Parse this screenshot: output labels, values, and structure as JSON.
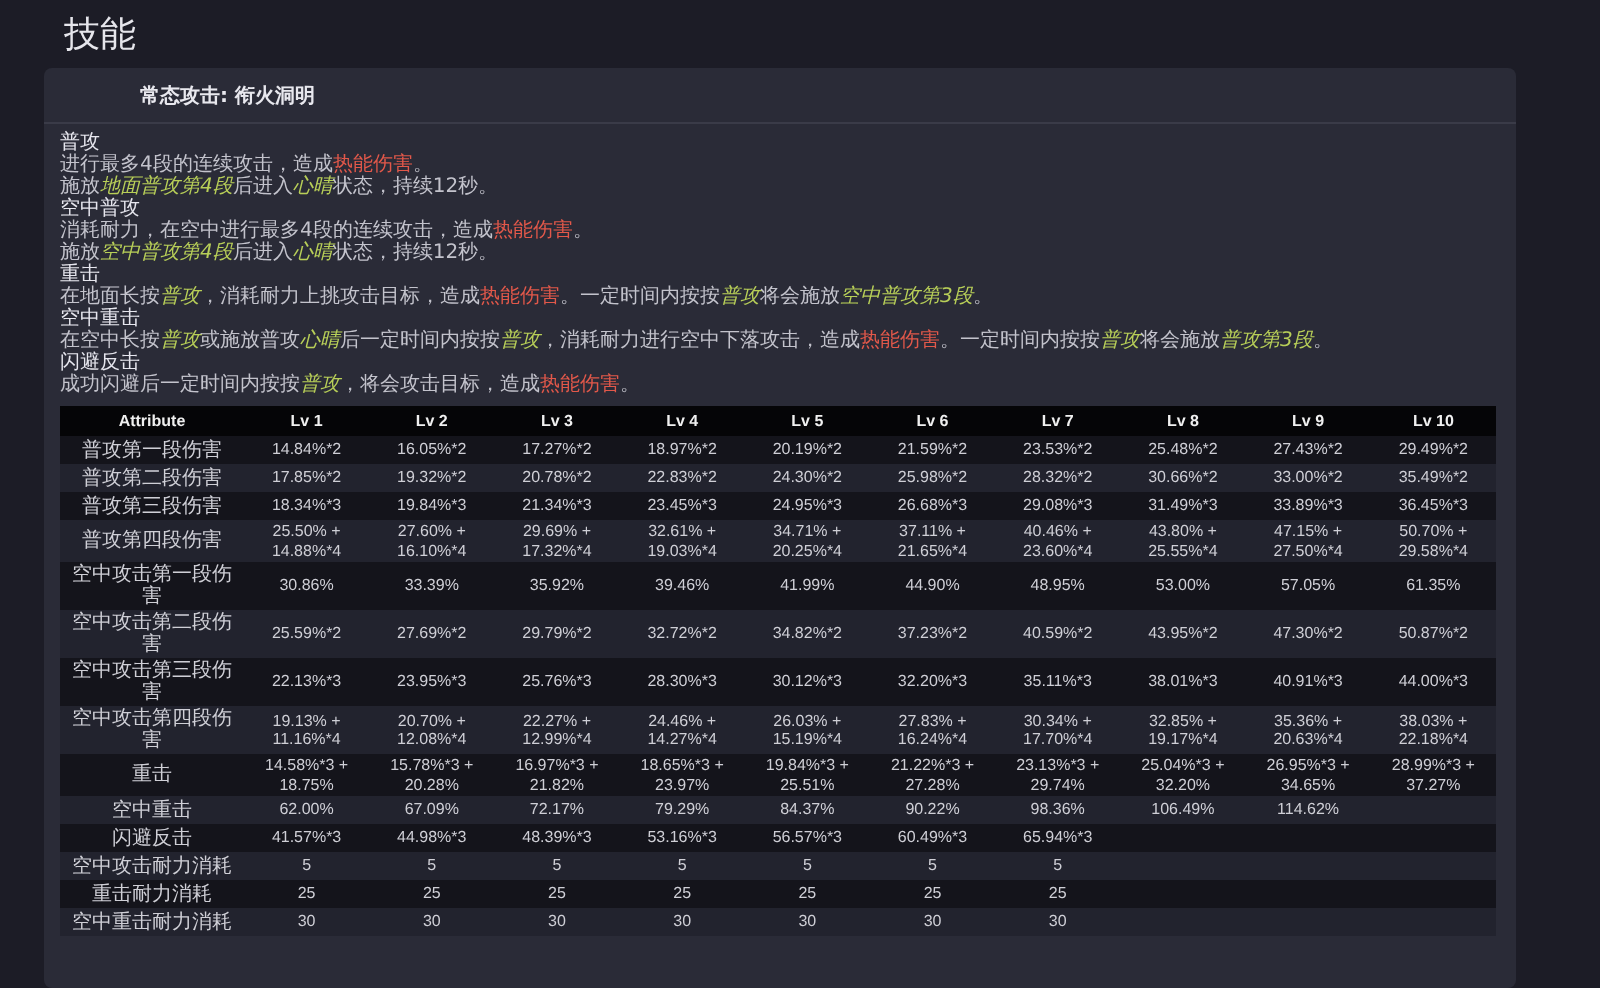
{
  "page_title": "技能",
  "card": {
    "title": "常态攻击: 衔火洞明",
    "description": [
      {
        "kind": "heading",
        "segments": [
          {
            "kind": "plain",
            "text": "普攻"
          }
        ]
      },
      {
        "kind": "text",
        "segments": [
          {
            "kind": "plain",
            "text": "进行最多4段的连续攻击，造成"
          },
          {
            "kind": "damage",
            "text": "热能伤害"
          },
          {
            "kind": "plain",
            "text": "。"
          }
        ]
      },
      {
        "kind": "text",
        "segments": [
          {
            "kind": "plain",
            "text": "施放"
          },
          {
            "kind": "keyword",
            "text": "地面普攻第4段"
          },
          {
            "kind": "plain",
            "text": "后进入"
          },
          {
            "kind": "keyword",
            "text": "心晴"
          },
          {
            "kind": "plain",
            "text": "状态，持续12秒。"
          }
        ]
      },
      {
        "kind": "heading",
        "segments": [
          {
            "kind": "plain",
            "text": "空中普攻"
          }
        ]
      },
      {
        "kind": "text",
        "segments": [
          {
            "kind": "plain",
            "text": "消耗耐力，在空中进行最多4段的连续攻击，造成"
          },
          {
            "kind": "damage",
            "text": "热能伤害"
          },
          {
            "kind": "plain",
            "text": "。"
          }
        ]
      },
      {
        "kind": "text",
        "segments": [
          {
            "kind": "plain",
            "text": "施放"
          },
          {
            "kind": "keyword",
            "text": "空中普攻第4段"
          },
          {
            "kind": "plain",
            "text": "后进入"
          },
          {
            "kind": "keyword",
            "text": "心晴"
          },
          {
            "kind": "plain",
            "text": "状态，持续12秒。"
          }
        ]
      },
      {
        "kind": "heading",
        "segments": [
          {
            "kind": "plain",
            "text": "重击"
          }
        ]
      },
      {
        "kind": "text",
        "segments": [
          {
            "kind": "plain",
            "text": "在地面长按"
          },
          {
            "kind": "keyword",
            "text": "普攻"
          },
          {
            "kind": "plain",
            "text": "，消耗耐力上挑攻击目标，造成"
          },
          {
            "kind": "damage",
            "text": "热能伤害"
          },
          {
            "kind": "plain",
            "text": "。一定时间内按按"
          },
          {
            "kind": "keyword",
            "text": "普攻"
          },
          {
            "kind": "plain",
            "text": "将会施放"
          },
          {
            "kind": "keyword",
            "text": "空中普攻第3段"
          },
          {
            "kind": "plain",
            "text": "。"
          }
        ]
      },
      {
        "kind": "heading",
        "segments": [
          {
            "kind": "plain",
            "text": "空中重击"
          }
        ]
      },
      {
        "kind": "text",
        "segments": [
          {
            "kind": "plain",
            "text": "在空中长按"
          },
          {
            "kind": "keyword",
            "text": "普攻"
          },
          {
            "kind": "plain",
            "text": "或施放普攻"
          },
          {
            "kind": "keyword",
            "text": "心晴"
          },
          {
            "kind": "plain",
            "text": "后一定时间内按按"
          },
          {
            "kind": "keyword",
            "text": "普攻"
          },
          {
            "kind": "plain",
            "text": "，消耗耐力进行空中下落攻击，造成"
          },
          {
            "kind": "damage",
            "text": "热能伤害"
          },
          {
            "kind": "plain",
            "text": "。一定时间内按按"
          },
          {
            "kind": "keyword",
            "text": "普攻"
          },
          {
            "kind": "plain",
            "text": "将会施放"
          },
          {
            "kind": "keyword",
            "text": "普攻第3段"
          },
          {
            "kind": "plain",
            "text": "。"
          }
        ]
      },
      {
        "kind": "heading",
        "segments": [
          {
            "kind": "plain",
            "text": "闪避反击"
          }
        ]
      },
      {
        "kind": "text",
        "segments": [
          {
            "kind": "plain",
            "text": "成功闪避后一定时间内按按"
          },
          {
            "kind": "keyword",
            "text": "普攻"
          },
          {
            "kind": "plain",
            "text": "，将会攻击目标，造成"
          },
          {
            "kind": "damage",
            "text": "热能伤害"
          },
          {
            "kind": "plain",
            "text": "。"
          }
        ]
      }
    ],
    "table": {
      "columns": [
        "Attribute",
        "Lv 1",
        "Lv 2",
        "Lv 3",
        "Lv 4",
        "Lv 5",
        "Lv 6",
        "Lv 7",
        "Lv 8",
        "Lv 9",
        "Lv 10"
      ],
      "rows": [
        [
          "普攻第一段伤害",
          "14.84%*2",
          "16.05%*2",
          "17.27%*2",
          "18.97%*2",
          "20.19%*2",
          "21.59%*2",
          "23.53%*2",
          "25.48%*2",
          "27.43%*2",
          "29.49%*2"
        ],
        [
          "普攻第二段伤害",
          "17.85%*2",
          "19.32%*2",
          "20.78%*2",
          "22.83%*2",
          "24.30%*2",
          "25.98%*2",
          "28.32%*2",
          "30.66%*2",
          "33.00%*2",
          "35.49%*2"
        ],
        [
          "普攻第三段伤害",
          "18.34%*3",
          "19.84%*3",
          "21.34%*3",
          "23.45%*3",
          "24.95%*3",
          "26.68%*3",
          "29.08%*3",
          "31.49%*3",
          "33.89%*3",
          "36.45%*3"
        ],
        [
          "普攻第四段伤害",
          "25.50% + 14.88%*4",
          "27.60% + 16.10%*4",
          "29.69% + 17.32%*4",
          "32.61% + 19.03%*4",
          "34.71% + 20.25%*4",
          "37.11% + 21.65%*4",
          "40.46% + 23.60%*4",
          "43.80% + 25.55%*4",
          "47.15% + 27.50%*4",
          "50.70% + 29.58%*4"
        ],
        [
          "空中攻击第一段伤害",
          "30.86%",
          "33.39%",
          "35.92%",
          "39.46%",
          "41.99%",
          "44.90%",
          "48.95%",
          "53.00%",
          "57.05%",
          "61.35%"
        ],
        [
          "空中攻击第二段伤害",
          "25.59%*2",
          "27.69%*2",
          "29.79%*2",
          "32.72%*2",
          "34.82%*2",
          "37.23%*2",
          "40.59%*2",
          "43.95%*2",
          "47.30%*2",
          "50.87%*2"
        ],
        [
          "空中攻击第三段伤害",
          "22.13%*3",
          "23.95%*3",
          "25.76%*3",
          "28.30%*3",
          "30.12%*3",
          "32.20%*3",
          "35.11%*3",
          "38.01%*3",
          "40.91%*3",
          "44.00%*3"
        ],
        [
          "空中攻击第四段伤害",
          "19.13% + 11.16%*4",
          "20.70% + 12.08%*4",
          "22.27% + 12.99%*4",
          "24.46% + 14.27%*4",
          "26.03% + 15.19%*4",
          "27.83% + 16.24%*4",
          "30.34% + 17.70%*4",
          "32.85% + 19.17%*4",
          "35.36% + 20.63%*4",
          "38.03% + 22.18%*4"
        ],
        [
          "重击",
          "14.58%*3 + 18.75%",
          "15.78%*3 + 20.28%",
          "16.97%*3 + 21.82%",
          "18.65%*3 + 23.97%",
          "19.84%*3 + 25.51%",
          "21.22%*3 + 27.28%",
          "23.13%*3 + 29.74%",
          "25.04%*3 + 32.20%",
          "26.95%*3 + 34.65%",
          "28.99%*3 + 37.27%"
        ],
        [
          "空中重击",
          "62.00%",
          "67.09%",
          "72.17%",
          "79.29%",
          "84.37%",
          "90.22%",
          "98.36%",
          "106.49%",
          "114.62%",
          null
        ],
        [
          "闪避反击",
          "41.57%*3",
          "44.98%*3",
          "48.39%*3",
          "53.16%*3",
          "56.57%*3",
          "60.49%*3",
          "65.94%*3",
          null,
          null,
          null
        ],
        [
          "空中攻击耐力消耗",
          "5",
          "5",
          "5",
          "5",
          "5",
          "5",
          "5",
          null,
          null,
          null
        ],
        [
          "重击耐力消耗",
          "25",
          "25",
          "25",
          "25",
          "25",
          "25",
          "25",
          null,
          null,
          null
        ],
        [
          "空中重击耐力消耗",
          "30",
          "30",
          "30",
          "30",
          "30",
          "30",
          "30",
          null,
          null,
          null
        ]
      ]
    }
  }
}
